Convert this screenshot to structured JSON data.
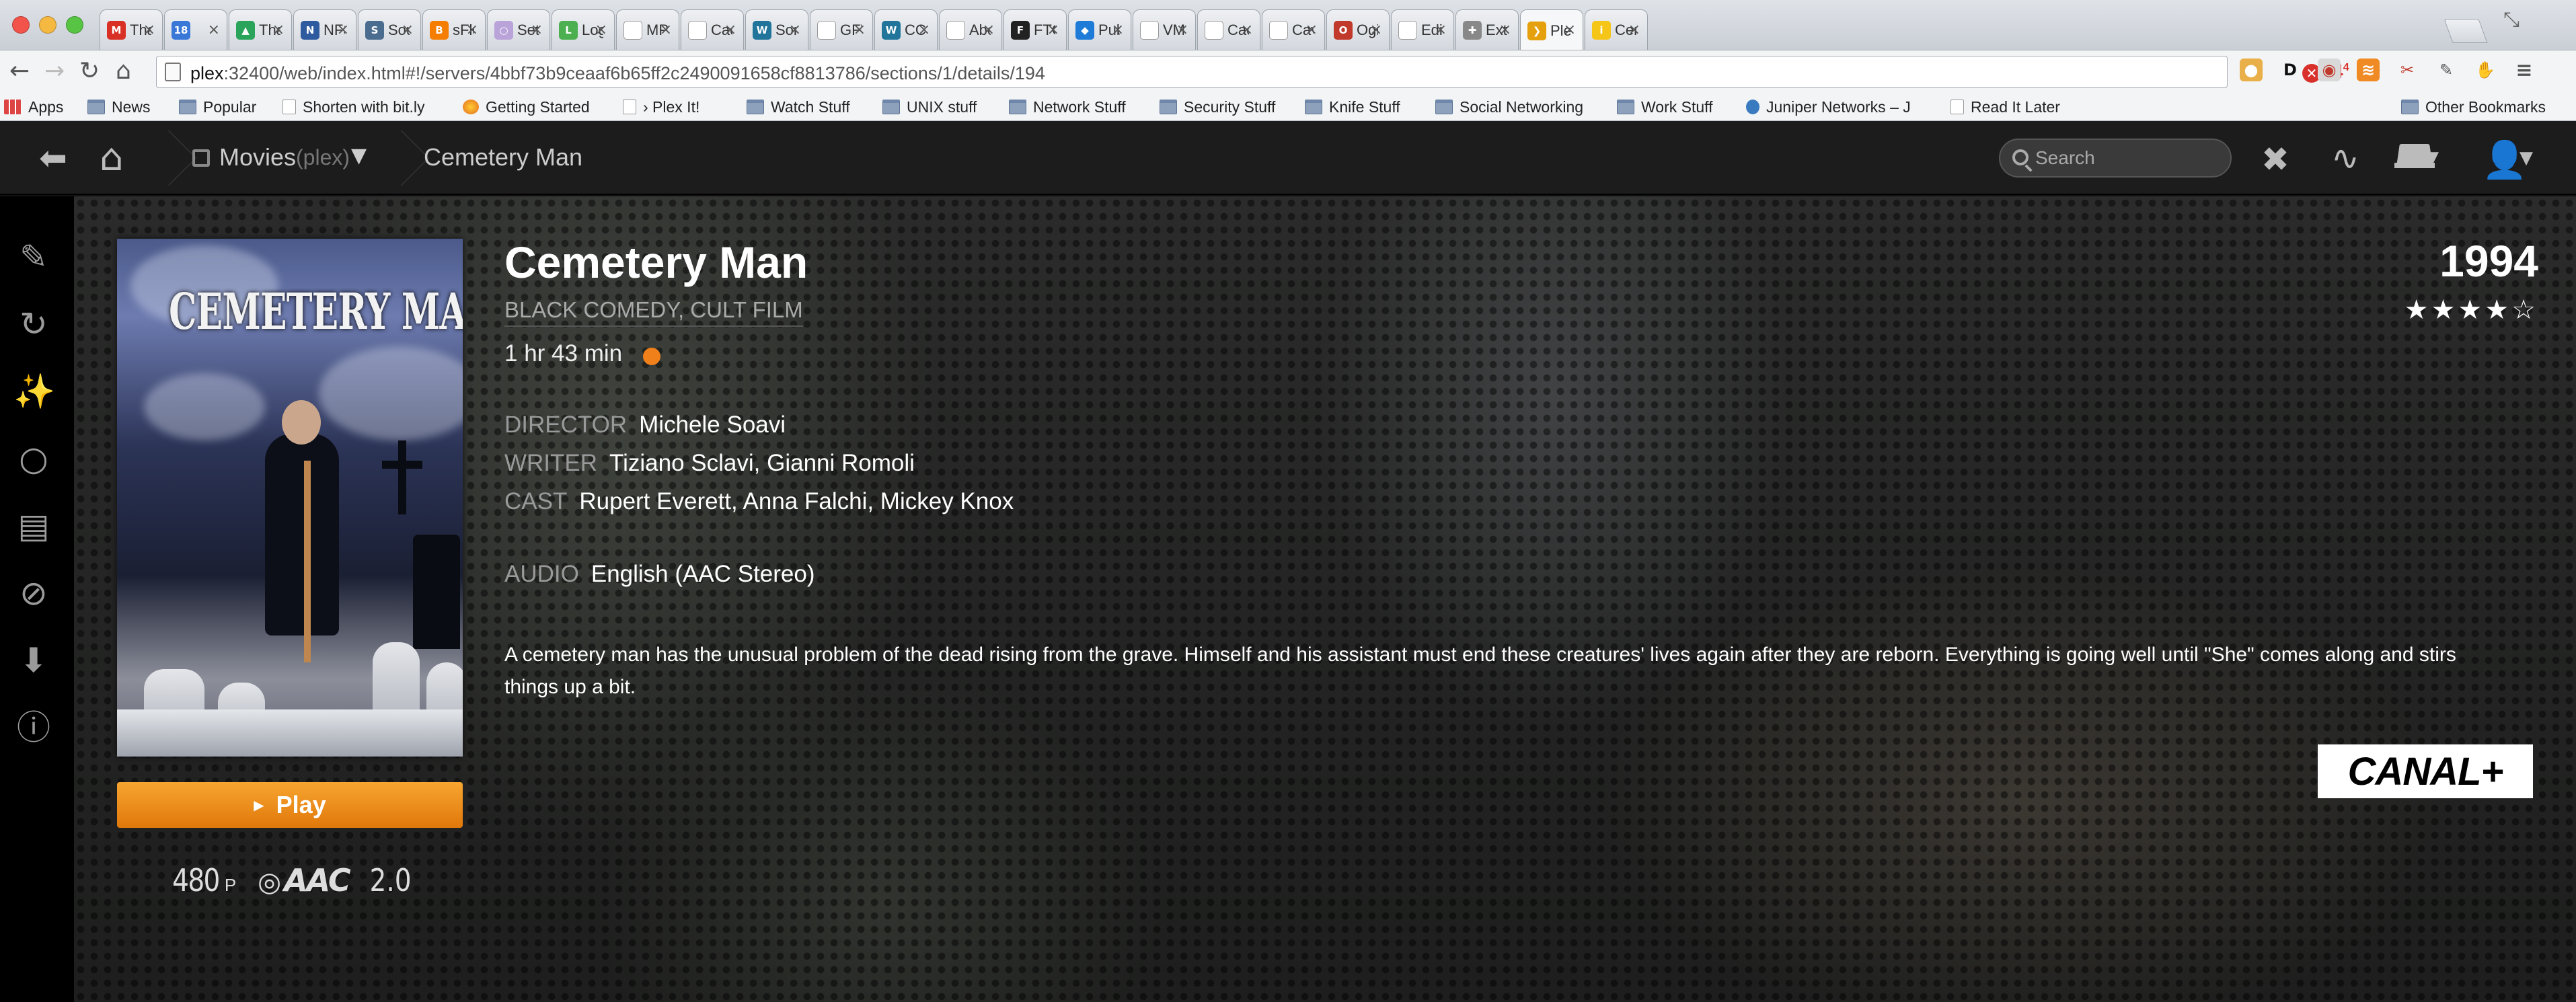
{
  "browser": {
    "tabs": [
      {
        "title": "Tha",
        "icon": "gmail-icon",
        "icon_char": "M",
        "color": "#d93025"
      },
      {
        "title": "",
        "icon": "calendar-icon",
        "icon_char": "18",
        "color": "#3a78d8"
      },
      {
        "title": "Tha",
        "icon": "drive-icon",
        "icon_char": "▲",
        "color": "#2aa45a"
      },
      {
        "title": "NFSE",
        "icon": "nfse-icon",
        "icon_char": "N",
        "color": "#2e5aa0"
      },
      {
        "title": "Sour",
        "icon": "sourceforge-icon",
        "icon_char": "S",
        "color": "#4a6c8f"
      },
      {
        "title": "sFlo",
        "icon": "blogger-icon",
        "icon_char": "B",
        "color": "#f57d00"
      },
      {
        "title": "Setu",
        "icon": "setup-icon",
        "icon_char": "○",
        "color": "#b9a3d9"
      },
      {
        "title": "Logi",
        "icon": "login-icon",
        "icon_char": "L",
        "color": "#4caf50"
      },
      {
        "title": "MPL",
        "icon": "page-icon",
        "icon_char": "",
        "color": "#ffffff"
      },
      {
        "title": "Cact",
        "icon": "page-icon",
        "icon_char": "",
        "color": "#ffffff"
      },
      {
        "title": "Soni",
        "icon": "wordpress-icon",
        "icon_char": "W",
        "color": "#21759b"
      },
      {
        "title": "GFW",
        "icon": "page-icon",
        "icon_char": "",
        "color": "#ffffff"
      },
      {
        "title": "CCIE",
        "icon": "wordpress-icon",
        "icon_char": "W",
        "color": "#21759b"
      },
      {
        "title": "Abo",
        "icon": "page-icon",
        "icon_char": "",
        "color": "#ffffff"
      },
      {
        "title": "FTC",
        "icon": "ftc-icon",
        "icon_char": "F",
        "color": "#222222"
      },
      {
        "title": "Publ",
        "icon": "dropbox-icon",
        "icon_char": "◆",
        "color": "#1f7bd8"
      },
      {
        "title": "VMw",
        "icon": "page-icon",
        "icon_char": "",
        "color": "#ffffff"
      },
      {
        "title": "Cact",
        "icon": "page-icon",
        "icon_char": "",
        "color": "#ffffff"
      },
      {
        "title": "Cava",
        "icon": "page-icon",
        "icon_char": "",
        "color": "#ffffff"
      },
      {
        "title": "Ogic",
        "icon": "ogic-icon",
        "icon_char": "O",
        "color": "#c0392b"
      },
      {
        "title": "Edit",
        "icon": "page-icon",
        "icon_char": "",
        "color": "#ffffff"
      },
      {
        "title": "Exte",
        "icon": "puzzle-icon",
        "icon_char": "✚",
        "color": "#888888"
      },
      {
        "title": "Plex",
        "icon": "plex-icon",
        "icon_char": "❯",
        "color": "#e5a00d",
        "active": true
      },
      {
        "title": "Cem",
        "icon": "imdb-icon",
        "icon_char": "i",
        "color": "#f5c518"
      }
    ],
    "url_host": "plex",
    "url_rest": ":32400/web/index.html#!/servers/4bbf73b9ceaaf6b65ff2c2490091658cf8813786/sections/1/details/194",
    "ext_count": "4",
    "ext_count_sup": "4",
    "bookmarks": [
      {
        "label": "Apps",
        "type": "apps"
      },
      {
        "label": "News",
        "type": "folder"
      },
      {
        "label": "Popular",
        "type": "folder"
      },
      {
        "label": "Shorten with bit.ly",
        "type": "page"
      },
      {
        "label": "Getting Started",
        "type": "firefox"
      },
      {
        "label": "› Plex It!",
        "type": "page"
      },
      {
        "label": "Watch Stuff",
        "type": "folder"
      },
      {
        "label": "UNIX stuff",
        "type": "folder"
      },
      {
        "label": "Network Stuff",
        "type": "folder"
      },
      {
        "label": "Security Stuff",
        "type": "folder"
      },
      {
        "label": "Knife Stuff",
        "type": "folder"
      },
      {
        "label": "Social Networking",
        "type": "folder"
      },
      {
        "label": "Work Stuff",
        "type": "folder"
      },
      {
        "label": "Juniper Networks – J",
        "type": "juniper"
      },
      {
        "label": "Read It Later",
        "type": "page"
      },
      {
        "label": "Other Bookmarks",
        "type": "folder"
      }
    ]
  },
  "plex": {
    "library": "Movies",
    "server": "(plex)",
    "crumb_title": "Cemetery Man",
    "search_placeholder": "Search"
  },
  "movie": {
    "poster_title": "CEMETERY MAN",
    "title": "Cemetery Man",
    "genres": "BLACK COMEDY, CULT FILM",
    "duration": "1 hr 43 min",
    "year": "1994",
    "rating_stars": 4,
    "rating_max": 5,
    "director_label": "DIRECTOR",
    "director": "Michele Soavi",
    "writer_label": "WRITER",
    "writer": "Tiziano Sclavi, Gianni Romoli",
    "cast_label": "CAST",
    "cast": "Rupert Everett, Anna Falchi, Mickey Knox",
    "audio_label": "AUDIO",
    "audio": "English (AAC Stereo)",
    "summary": "A cemetery man has the unusual problem of the dead rising from the grave. Himself and his assistant must end these creatures' lives again after they are reborn. Everything is going well until \"She\" comes along and stirs things up a bit.",
    "play_label": "Play",
    "resolution": "480",
    "resolution_suffix": "P",
    "audio_codec": "AAC",
    "audio_channels": "2.0",
    "studio": "CANAL+"
  }
}
